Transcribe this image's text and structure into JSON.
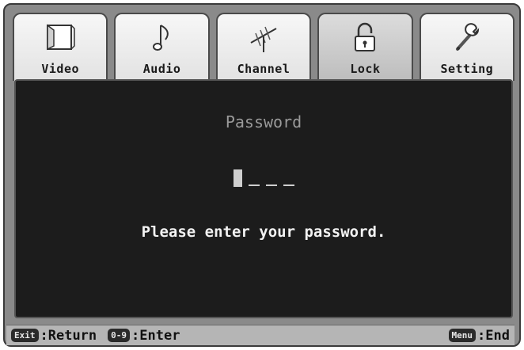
{
  "tabs": [
    {
      "label": "Video",
      "icon": "tv-screen-icon"
    },
    {
      "label": "Audio",
      "icon": "music-note-icon"
    },
    {
      "label": "Channel",
      "icon": "antenna-icon"
    },
    {
      "label": "Lock",
      "icon": "padlock-icon",
      "active": true
    },
    {
      "label": "Setting",
      "icon": "wrench-icon"
    }
  ],
  "panel": {
    "title": "Password",
    "message": "Please enter your password."
  },
  "footer": {
    "exit_key": "Exit",
    "exit_label": ":Return",
    "digits_key": "0-9",
    "digits_label": ":Enter",
    "menu_key": "Menu",
    "menu_label": ":End"
  },
  "colors": {
    "panel_bg": "#1c1c1c",
    "tab_bg": "#efefef",
    "active_tab_bg": "#c8c8c8",
    "footer_bg": "#b5b5b5"
  }
}
